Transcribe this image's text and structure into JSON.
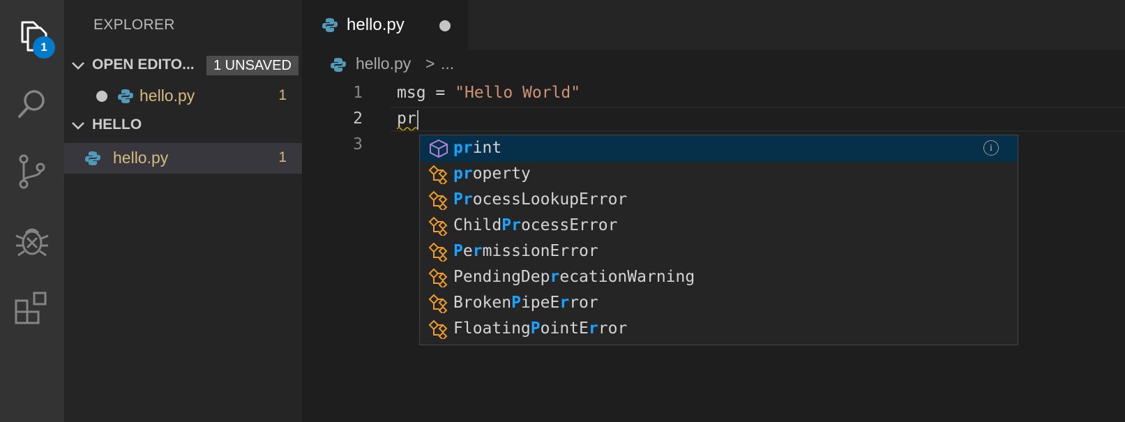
{
  "activity_bar": {
    "explorer_badge": "1",
    "icons": [
      "files-icon",
      "search-icon",
      "source-control-icon",
      "debug-icon",
      "extensions-icon"
    ]
  },
  "sidebar": {
    "title": "EXPLORER",
    "open_editors": {
      "label": "OPEN EDITO...",
      "badge": "1 UNSAVED",
      "files": [
        {
          "name": "hello.py",
          "problems": "1"
        }
      ]
    },
    "folder": {
      "label": "HELLO",
      "files": [
        {
          "name": "hello.py",
          "problems": "1"
        }
      ]
    }
  },
  "tabs": [
    {
      "label": "hello.py",
      "dirty": true
    }
  ],
  "breadcrumb": {
    "file": "hello.py",
    "separator": ">",
    "more": "..."
  },
  "editor": {
    "lines": [
      {
        "number": "1",
        "var": "msg",
        "op": " = ",
        "string": "\"Hello World\""
      },
      {
        "number": "2",
        "text": "pr"
      },
      {
        "number": "3",
        "text": ""
      }
    ]
  },
  "suggestions": [
    {
      "kind": "function",
      "parts": [
        [
          "pr",
          true
        ],
        [
          "int",
          false
        ]
      ],
      "selected": true
    },
    {
      "kind": "class",
      "parts": [
        [
          "pr",
          true
        ],
        [
          "operty",
          false
        ]
      ]
    },
    {
      "kind": "class",
      "parts": [
        [
          "Pr",
          true
        ],
        [
          "ocessLookupError",
          false
        ]
      ]
    },
    {
      "kind": "class",
      "parts": [
        [
          "Child",
          false
        ],
        [
          "Pr",
          true
        ],
        [
          "ocessError",
          false
        ]
      ]
    },
    {
      "kind": "class",
      "parts": [
        [
          "P",
          true
        ],
        [
          "e",
          false
        ],
        [
          "r",
          true
        ],
        [
          "missionError",
          false
        ]
      ]
    },
    {
      "kind": "class",
      "parts": [
        [
          "PendingDep",
          false
        ],
        [
          "r",
          true
        ],
        [
          "ecationWarning",
          false
        ]
      ]
    },
    {
      "kind": "class",
      "parts": [
        [
          "Broken",
          false
        ],
        [
          "P",
          true
        ],
        [
          "ipeE",
          false
        ],
        [
          "r",
          true
        ],
        [
          "ror",
          false
        ]
      ]
    },
    {
      "kind": "class",
      "parts": [
        [
          "Floating",
          false
        ],
        [
          "P",
          true
        ],
        [
          "ointE",
          false
        ],
        [
          "r",
          true
        ],
        [
          "ror",
          false
        ]
      ]
    }
  ],
  "suggest_info_glyph": "i",
  "colors": {
    "accent": "#007acc",
    "modified": "#d7ba7d",
    "match": "#18a3ff",
    "string": "#ce9178",
    "selection": "#062f4a"
  }
}
